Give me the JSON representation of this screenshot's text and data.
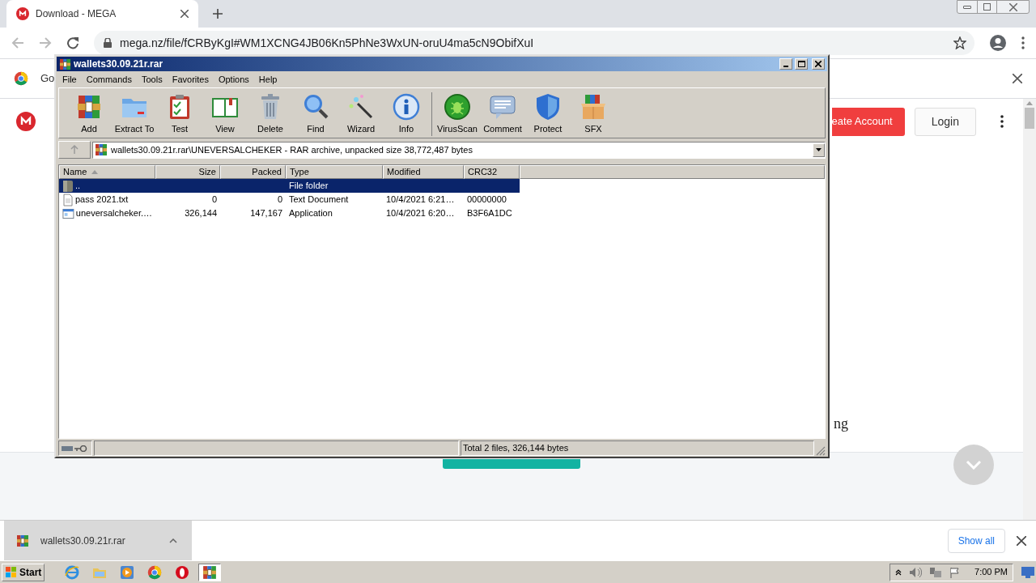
{
  "browser": {
    "tab": {
      "title": "Download - MEGA"
    },
    "url": "mega.nz/file/fCRByKgI#WM1XCNG4JB06Kn5PhNe3WxUN-oruU4ma5cN9ObifXuI",
    "infobar": {
      "text": "Go"
    }
  },
  "page": {
    "buttons": [
      {
        "label": "eate Account",
        "kind": "primary"
      },
      {
        "label": "Login",
        "kind": "secondary"
      }
    ],
    "text_fragment": "ng"
  },
  "download_bar": {
    "items": [
      {
        "name": "wallets30.09.21r.rar"
      }
    ],
    "show_all": "Show all"
  },
  "taskbar": {
    "start": "Start",
    "apps": [
      {
        "kind": "ie",
        "selected": false
      },
      {
        "kind": "explorer",
        "selected": false
      },
      {
        "kind": "media",
        "selected": false
      },
      {
        "kind": "chrome",
        "selected": false
      },
      {
        "kind": "opera",
        "selected": false
      },
      {
        "kind": "winrar",
        "selected": true
      }
    ],
    "clock": "7:00 PM"
  },
  "winrar": {
    "title": "wallets30.09.21r.rar",
    "menu": [
      "File",
      "Commands",
      "Tools",
      "Favorites",
      "Options",
      "Help"
    ],
    "toolbar_groups": [
      {
        "buttons": [
          {
            "label": "Add",
            "kind": "add"
          },
          {
            "label": "Extract To",
            "kind": "extract"
          },
          {
            "label": "Test",
            "kind": "test"
          },
          {
            "label": "View",
            "kind": "view"
          },
          {
            "label": "Delete",
            "kind": "delete"
          },
          {
            "label": "Find",
            "kind": "find"
          },
          {
            "label": "Wizard",
            "kind": "wizard"
          },
          {
            "label": "Info",
            "kind": "info"
          }
        ]
      },
      {
        "buttons": [
          {
            "label": "VirusScan",
            "kind": "virusscan"
          },
          {
            "label": "Comment",
            "kind": "comment"
          },
          {
            "label": "Protect",
            "kind": "protect"
          },
          {
            "label": "SFX",
            "kind": "sfx"
          }
        ]
      }
    ],
    "path": "wallets30.09.21r.rar\\UNEVERSALCHEKER - RAR archive, unpacked size 38,772,487 bytes",
    "columns": [
      {
        "label": "Name",
        "sorted": true
      },
      {
        "label": "Size",
        "sorted": false
      },
      {
        "label": "Packed",
        "sorted": false
      },
      {
        "label": "Type",
        "sorted": false
      },
      {
        "label": "Modified",
        "sorted": false
      },
      {
        "label": "CRC32",
        "sorted": false
      }
    ],
    "rows": [
      {
        "kind": "folder",
        "selected": true,
        "name": "..",
        "type": "File folder"
      },
      {
        "kind": "text",
        "selected": false,
        "name": "pass 2021.txt",
        "size": "0",
        "packed": "0",
        "type": "Text Document",
        "modified": "10/4/2021 6:21…",
        "crc32": "00000000"
      },
      {
        "kind": "app",
        "selected": false,
        "name": "uneversalcheker.…",
        "size": "326,144",
        "packed": "147,167",
        "type": "Application",
        "modified": "10/4/2021 6:20…",
        "crc32": "B3F6A1DC"
      }
    ],
    "status": "Total 2 files, 326,144 bytes"
  }
}
